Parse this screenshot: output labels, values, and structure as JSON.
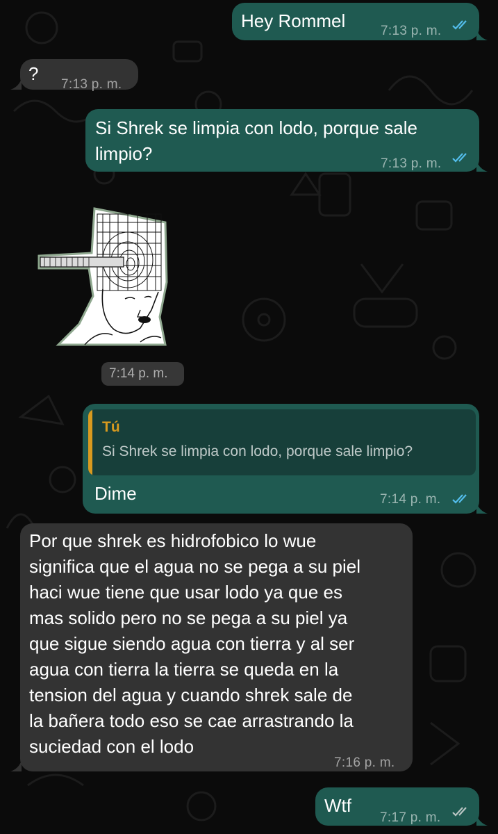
{
  "colors": {
    "outgoing_bubble": "#1f5a51",
    "incoming_bubble": "#333333",
    "read_ticks": "#53bdeb",
    "reply_accent": "#d89a1f"
  },
  "messages": [
    {
      "direction": "outgoing",
      "text": "Hey Rommel",
      "time": "7:13 p. m.",
      "status": "read"
    },
    {
      "direction": "incoming",
      "text": "?",
      "time": "7:13 p. m."
    },
    {
      "direction": "outgoing",
      "text": "Si Shrek se limpia con lodo, porque sale limpio?",
      "time": "7:13 p. m.",
      "status": "read"
    },
    {
      "direction": "incoming",
      "type": "sticker",
      "sticker": "wojak-brain-vortex-sticker",
      "time": "7:14 p. m."
    },
    {
      "direction": "outgoing",
      "reply_to": {
        "author": "Tú",
        "text": "Si Shrek se limpia con lodo, porque sale limpio?"
      },
      "text": "Dime",
      "time": "7:14 p. m.",
      "status": "read"
    },
    {
      "direction": "incoming",
      "lines": [
        "Por que shrek es hidrofobico lo wue",
        "significa que el agua no se pega a su piel",
        "haci wue tiene que usar lodo ya que es",
        "mas solido pero no se pega a su piel ya",
        "que sigue siendo agua con tierra y al ser",
        "agua con tierra la tierra se queda en la",
        "tension del agua y cuando shrek sale de",
        "la bañera todo eso se cae arrastrando la",
        "suciedad con el lodo"
      ],
      "time": "7:16 p. m."
    },
    {
      "direction": "outgoing",
      "text": "Wtf",
      "time": "7:17 p. m.",
      "status": "delivered"
    }
  ]
}
